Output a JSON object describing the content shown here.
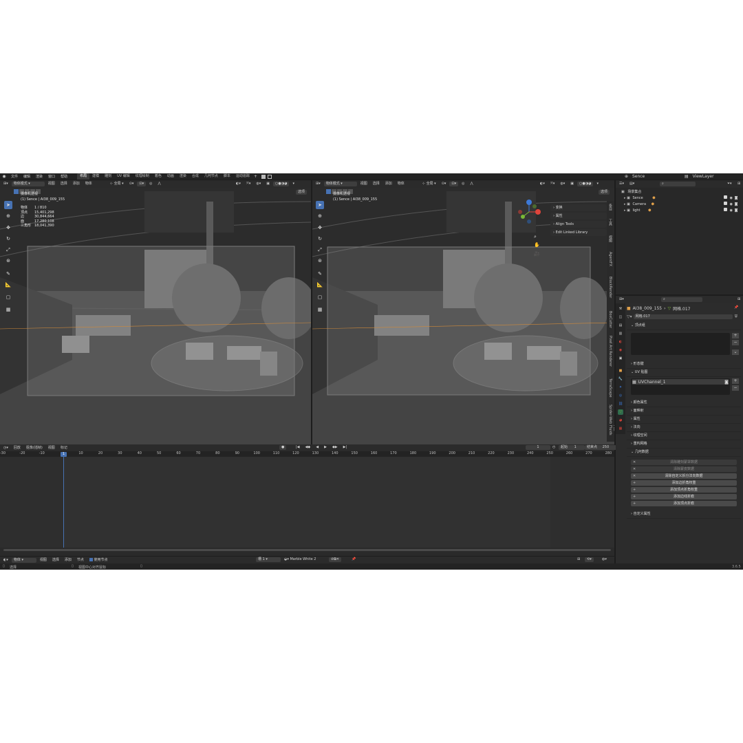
{
  "topbar": {
    "menus": [
      "文件",
      "编辑",
      "渲染",
      "窗口",
      "帮助"
    ],
    "workspaces": [
      "布局",
      "建模",
      "雕刻",
      "UV 编辑",
      "纹理绘制",
      "着色",
      "动画",
      "渲染",
      "合成",
      "几何节点",
      "脚本",
      "运动追踪"
    ],
    "active_workspace": "布局",
    "scene": "Sence",
    "view_layer": "ViewLayer"
  },
  "viewport_left": {
    "mode": "物体模式",
    "menus": [
      "视图",
      "选择",
      "添加",
      "物体"
    ],
    "transform": "全局",
    "options": "选项",
    "camera_title": "摄像机透视",
    "object_name": "(1) Sence | AI38_009_155",
    "stats": [
      {
        "label": "物体",
        "value": "1 / 810"
      },
      {
        "label": "顶点",
        "value": "15,401,298"
      },
      {
        "label": "边",
        "value": "30,844,664"
      },
      {
        "label": "面",
        "value": "17,280,108"
      },
      {
        "label": "三角形",
        "value": "18,041,390"
      }
    ]
  },
  "viewport_right": {
    "mode": "物体模式",
    "menus": [
      "视图",
      "选择",
      "添加",
      "物体"
    ],
    "transform": "全局",
    "options": "选项",
    "camera_title": "摄像机透视",
    "object_name": "(1) Sence | AI38_009_155",
    "npanel": [
      "变换",
      "属性",
      "Align Tools",
      "Edit Linked Library"
    ],
    "side_tabs": [
      "条目",
      "工具",
      "视图",
      "AgentFX",
      "BlockRender",
      "BoxCutter",
      "Pixel Art Renderer",
      "TerraScape",
      "Spider-Web",
      "FLIP Fluids"
    ]
  },
  "timeline": {
    "menus": [
      "回放",
      "抠像(插帧)",
      "视图",
      "标记"
    ],
    "current_frame": "1",
    "start_label": "起始",
    "start": "1",
    "end_label": "结束点",
    "end": "250",
    "ruler": [
      "-30",
      "-20",
      "-10",
      "1",
      "10",
      "20",
      "30",
      "40",
      "50",
      "60",
      "70",
      "80",
      "90",
      "100",
      "110",
      "120",
      "130",
      "140",
      "150",
      "160",
      "170",
      "180",
      "190",
      "200",
      "210",
      "220",
      "230",
      "240",
      "250",
      "260",
      "270",
      "280"
    ],
    "playhead": "1"
  },
  "bottom_editor": {
    "mode": "物体",
    "menus": [
      "视图",
      "选择",
      "添加",
      "节点"
    ],
    "use_nodes": "使用节点",
    "slot": "槽 1",
    "material": "Marble White 2"
  },
  "statusbar": {
    "left": "选择",
    "center": "视图中心对齐鼠标",
    "version": "3.6.5"
  },
  "outliner": {
    "root": "场景集合",
    "items": [
      "Sence",
      "Camera",
      "light"
    ]
  },
  "properties": {
    "object": "AI38_009_155",
    "mesh": "网格.017",
    "mesh_field": "网格.017",
    "sections": {
      "vertex_groups": "顶点组",
      "shape_keys": "形态键",
      "uv_maps": "UV 贴图",
      "uv_channel": "UVChannel_1",
      "color_attributes": "颜色属性",
      "face_maps": "面映射",
      "attributes": "属性",
      "normals": "法向",
      "texture_space": "纹理空间",
      "remesh": "重构网格",
      "geometry_data": "几何数据",
      "custom_props": "自定义属性"
    },
    "geo_buttons": [
      "清除雕刻蒙罩数据",
      "清除蒙皮数据",
      "清除自定义拆分法向数据",
      "添加边折角权重",
      "添加顶点折角权重",
      "添加边线折痕",
      "添加顶点折痕"
    ]
  },
  "colors": {
    "accent": "#4772b3",
    "axis_x": "#e0443b",
    "axis_y": "#7ab836",
    "axis_z": "#3d7ad9"
  }
}
